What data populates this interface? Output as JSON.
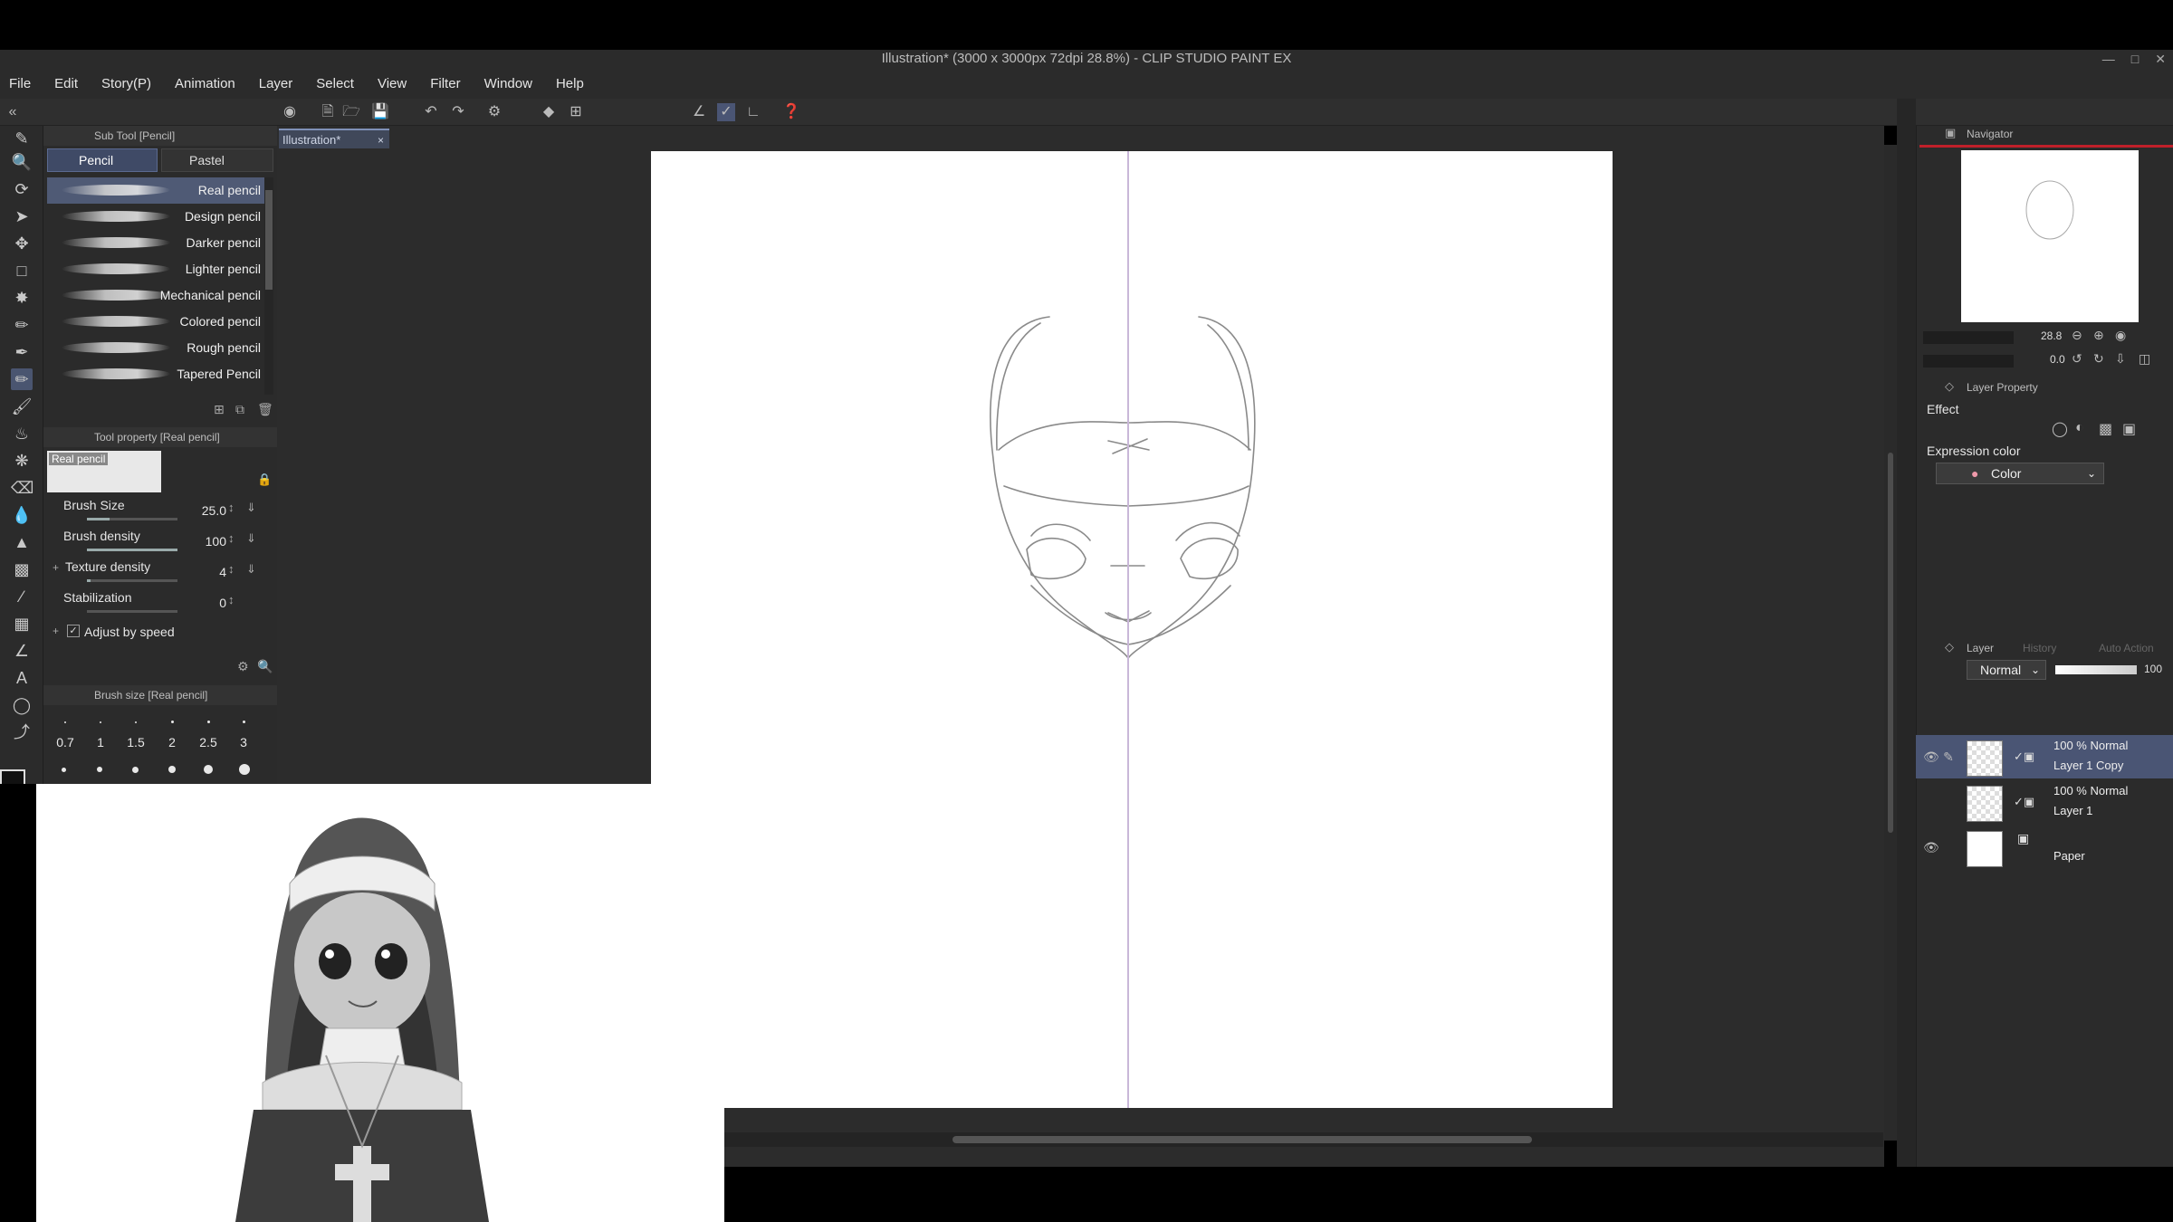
{
  "window": {
    "title": "Illustration* (3000 x 3000px 72dpi 28.8%) - CLIP STUDIO PAINT EX",
    "controls": [
      "—",
      "□",
      "✕"
    ]
  },
  "menu": [
    "File",
    "Edit",
    "Story(P)",
    "Animation",
    "Layer",
    "Select",
    "View",
    "Filter",
    "Window",
    "Help"
  ],
  "subtool": {
    "header": "Sub Tool [Pencil]",
    "tabs": [
      "Pencil",
      "Pastel"
    ],
    "brushes": [
      "Real pencil",
      "Design pencil",
      "Darker pencil",
      "Lighter pencil",
      "Mechanical pencil",
      "Colored pencil",
      "Rough pencil",
      "Tapered Pencil"
    ],
    "selected_index": 0
  },
  "tool_property": {
    "header": "Tool property [Real pencil]",
    "preview_label": "Real pencil",
    "brush_size_label": "Brush Size",
    "brush_size": "25.0",
    "brush_size_fraction": 0.25,
    "brush_density_label": "Brush density",
    "brush_density": "100",
    "brush_density_fraction": 1.0,
    "texture_density_label": "Texture density",
    "texture_density": "4",
    "texture_density_fraction": 0.04,
    "stabilization_label": "Stabilization",
    "stabilization": "0",
    "stabilization_fraction": 0.0,
    "adjust_speed_label": "Adjust by speed",
    "adjust_speed_checked": true
  },
  "brush_size_panel": {
    "header": "Brush size [Real pencil]",
    "sizes": [
      "0.7",
      "1",
      "1.5",
      "2",
      "2.5",
      "3"
    ]
  },
  "canvas": {
    "tab_label": "Illustration*",
    "tab_close": "×"
  },
  "navigator": {
    "header": "Navigator",
    "zoom": "28.8",
    "rotation": "0.0"
  },
  "layer_property": {
    "header": "Layer Property",
    "effect_label": "Effect",
    "expression_color_label": "Expression color",
    "expression_color_value": "Color"
  },
  "layer_panel": {
    "header": "Layer",
    "tab_history": "History",
    "tab_auto_action": "Auto Action",
    "blend_mode": "Normal",
    "opacity": "100",
    "layers": [
      {
        "blend": "100 % Normal",
        "name": "Layer 1 Copy",
        "selected": true
      },
      {
        "blend": "100 % Normal",
        "name": "Layer 1",
        "selected": false
      },
      {
        "blend": "",
        "name": "Paper",
        "selected": false
      }
    ]
  },
  "colors": {
    "accent": "#4a5574",
    "navigator_red": "#c0202a",
    "guide": "#c9b7d8"
  }
}
